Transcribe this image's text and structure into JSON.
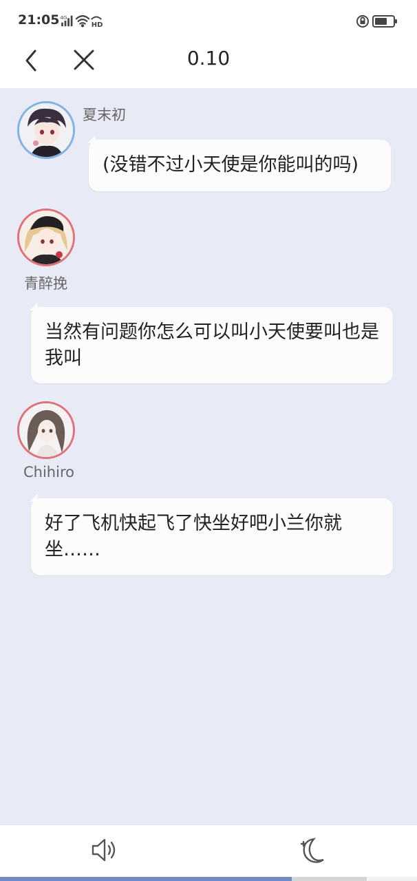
{
  "status_bar": {
    "time": "21:05",
    "network": "4G",
    "hd": "HD",
    "left_icons": [
      "signal-icon",
      "wifi-icon",
      "hd-icon"
    ],
    "right_icons": [
      "lock-rotation-icon",
      "battery-icon"
    ]
  },
  "header": {
    "title": "0.10",
    "back_icon": "chevron-left-icon",
    "close_icon": "close-icon"
  },
  "messages": [
    {
      "sender": "夏末初",
      "text": "(没错不过小天使是你能叫的吗)",
      "avatar_ring_color": "#7fb2e5"
    },
    {
      "sender": "青醉挽",
      "text": "当然有问题你怎么可以叫小天使要叫也是我叫",
      "avatar_ring_color": "#e0707a"
    },
    {
      "sender": "Chihiro",
      "text": "好了飞机快起飞了快坐好吧小兰你就坐……",
      "avatar_ring_color": "#e0707a"
    }
  ],
  "bottom_bar": {
    "sound_icon": "speaker-icon",
    "night_icon": "moon-icon",
    "progress": 0.7
  },
  "colors": {
    "chat_background": "#e8eaf6",
    "bubble_background": "#fcfcfc",
    "progress_fill": "#6f8ac4"
  }
}
